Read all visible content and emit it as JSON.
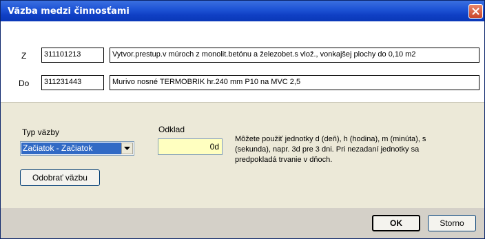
{
  "window": {
    "title": "Väzba medzi činnosťami"
  },
  "from": {
    "label": "Z",
    "code": "311101213",
    "description": "Vytvor.prestup.v múroch z monolit.betónu a železobet.s vlož., vonkajšej plochy do 0,10 m2"
  },
  "to": {
    "label": "Do",
    "code": "311231443",
    "description": "Murivo nosné TERMOBRIK hr.240 mm P10 na MVC 2,5"
  },
  "link_type": {
    "label": "Typ väzby",
    "selected": "Začiatok - Začiatok"
  },
  "delay": {
    "label": "Odklad",
    "value": "0d",
    "help": "Môžete použiť jednotky d (deň), h (hodina), m (minúta), s (sekunda), napr. 3d pre 3 dni. Pri nezadaní jednotky sa predpokladá trvanie v dňoch."
  },
  "buttons": {
    "remove_label": "Odobrať väzbu",
    "ok_label": "OK",
    "cancel_label": "Storno"
  },
  "icons": {
    "close": "close-icon",
    "dropdown": "chevron-down-icon"
  }
}
